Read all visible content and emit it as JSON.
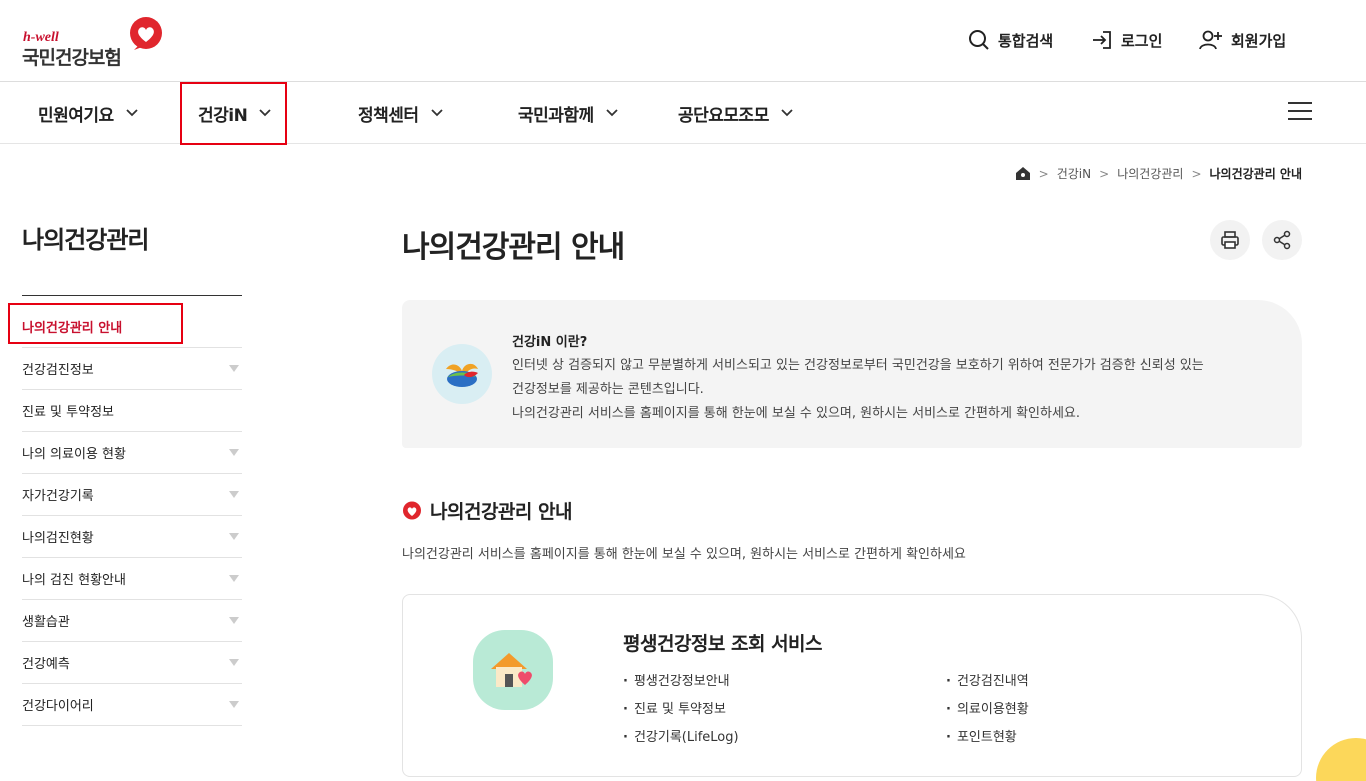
{
  "header": {
    "logo_small": "h-well",
    "logo_main": "국민건강보험",
    "utils": [
      {
        "label": "통합검색",
        "icon": "search-icon"
      },
      {
        "label": "로그인",
        "icon": "login-icon"
      },
      {
        "label": "회원가입",
        "icon": "user-plus-icon"
      }
    ]
  },
  "gnb": {
    "items": [
      {
        "label": "민원여기요"
      },
      {
        "label": "건강iN"
      },
      {
        "label": "정책센터"
      },
      {
        "label": "국민과함께"
      },
      {
        "label": "공단요모조모"
      }
    ]
  },
  "breadcrumb": {
    "items": [
      "건강iN",
      "나의건강관리",
      "나의건강관리 안내"
    ]
  },
  "sidebar": {
    "title": "나의건강관리",
    "items": [
      {
        "label": "나의건강관리 안내",
        "active": true,
        "expandable": false
      },
      {
        "label": "건강검진정보",
        "expandable": true
      },
      {
        "label": "진료 및 투약정보",
        "expandable": false
      },
      {
        "label": "나의 의료이용 현황",
        "expandable": true
      },
      {
        "label": "자가건강기록",
        "expandable": true
      },
      {
        "label": "나의검진현황",
        "expandable": true
      },
      {
        "label": "나의 검진 현황안내",
        "expandable": true
      },
      {
        "label": "생활습관",
        "expandable": true
      },
      {
        "label": "건강예측",
        "expandable": true
      },
      {
        "label": "건강다이어리",
        "expandable": true
      }
    ]
  },
  "main": {
    "title": "나의건강관리 안내",
    "intro": {
      "title": "건강iN 이란?",
      "lines": [
        "인터넷 상 검증되지 않고 무분별하게 서비스되고 있는 건강정보로부터 국민건강을 보호하기 위하여 전문가가 검증한 신뢰성 있는",
        "건강정보를 제공하는 콘텐츠입니다.",
        "나의건강관리 서비스를 홈페이지를 통해 한눈에 보실 수 있으며, 원하시는 서비스로 간편하게 확인하세요."
      ]
    },
    "section": {
      "title": "나의건강관리 안내",
      "desc": "나의건강관리 서비스를 홈페이지를 통해 한눈에 보실 수 있으며, 원하시는 서비스로 간편하게 확인하세요"
    },
    "card": {
      "title": "평생건강정보 조회 서비스",
      "items_left": [
        "평생건강정보안내",
        "진료 및 투약정보",
        "건강기록(LifeLog)"
      ],
      "items_right": [
        "건강검진내역",
        "의료이용현황",
        "포인트현황"
      ]
    }
  },
  "colors": {
    "brand_red": "#c8102e",
    "highlight_box": "#e60012",
    "card_icon_bg": "#b9ead6",
    "intro_bg": "#f4f4f4"
  }
}
